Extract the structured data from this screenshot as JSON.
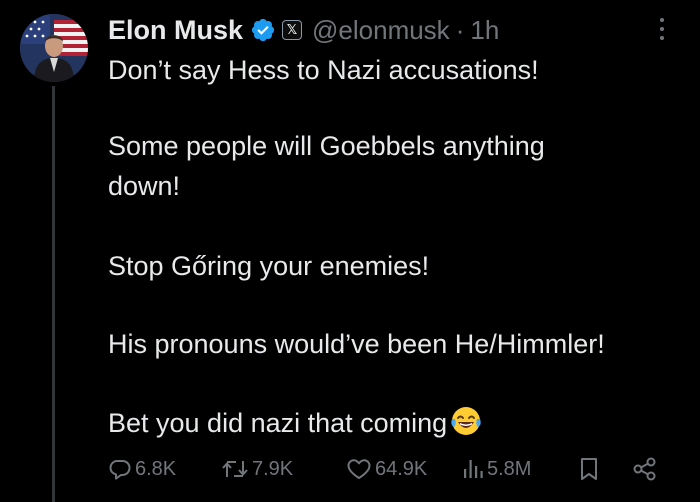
{
  "post": {
    "author_name": "Elon Musk",
    "handle": "@elonmusk",
    "separator": "·",
    "time": "1h",
    "lines": [
      "Don’t say Hess to Nazi accusations!",
      "Some people will Goebbels anything",
      "down!",
      "Stop Gőring your enemies!",
      "His pronouns would’ve been He/Himmler!",
      "Bet you did nazi that coming"
    ]
  },
  "metrics": {
    "replies": "6.8K",
    "reposts": "7.9K",
    "likes": "64.9K",
    "views": "5.8M"
  },
  "icons": {
    "verified": "verified-badge-icon",
    "x_logo": "x-logo-icon",
    "more": "more-options-icon",
    "reply": "reply-icon",
    "repost": "repost-icon",
    "like": "heart-icon",
    "views": "views-chart-icon",
    "bookmark": "bookmark-icon",
    "share": "share-icon",
    "emoji": "laughing-tears-emoji-icon"
  },
  "colors": {
    "background": "#000000",
    "text": "#e7e9ea",
    "secondary_text": "#71767b",
    "verified_blue": "#1d9bf0",
    "thread_line": "#333639"
  }
}
